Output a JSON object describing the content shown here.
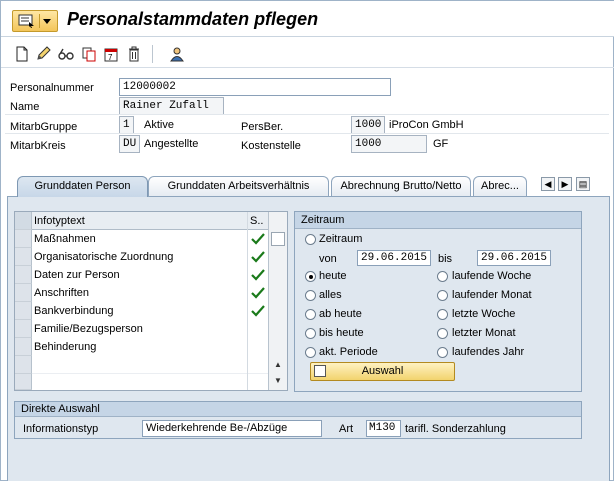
{
  "window": {
    "title": "Personalstammdaten pflegen"
  },
  "toolbar": {
    "icons": [
      "create-icon",
      "change-icon",
      "display-icon",
      "copy-icon",
      "delimit-icon",
      "delete-icon",
      "person-icon"
    ]
  },
  "header": {
    "personalnummer_label": "Personalnummer",
    "personalnummer_value": "12000002",
    "name_label": "Name",
    "name_value": "Rainer Zufall",
    "mitarbgruppe_label": "MitarbGruppe",
    "mitarbgruppe_code": "1",
    "mitarbgruppe_text": "Aktive",
    "persber_label": "PersBer.",
    "persber_code": "1000",
    "persber_text": "iProCon GmbH",
    "mitarbkreis_label": "MitarbKreis",
    "mitarbkreis_code": "DU",
    "mitarbkreis_text": "Angestellte",
    "kostenstelle_label": "Kostenstelle",
    "kostenstelle_code": "1000",
    "kostenstelle_text": "GF"
  },
  "tabs": [
    {
      "label": "Grunddaten Person",
      "active": true
    },
    {
      "label": "Grunddaten Arbeitsverhältnis",
      "active": false
    },
    {
      "label": "Abrechnung Brutto/Netto",
      "active": false
    },
    {
      "label": "Abrec...",
      "active": false
    }
  ],
  "infotypen": {
    "col_text": "Infotyptext",
    "col_s": "S..",
    "rows": [
      {
        "text": "Maßnahmen",
        "checked": true
      },
      {
        "text": "Organisatorische Zuordnung",
        "checked": true
      },
      {
        "text": "Daten zur Person",
        "checked": true
      },
      {
        "text": "Anschriften",
        "checked": true
      },
      {
        "text": "Bankverbindung",
        "checked": true
      },
      {
        "text": "Familie/Bezugsperson",
        "checked": false
      },
      {
        "text": "Behinderung",
        "checked": false
      }
    ]
  },
  "zeitraum": {
    "title": "Zeitraum",
    "option_zeitraum": "Zeitraum",
    "von_label": "von",
    "von_value": "29.06.2015",
    "bis_label": "bis",
    "bis_value": "29.06.2015",
    "options_left": [
      "heute",
      "alles",
      "ab heute",
      "bis heute",
      "akt. Periode"
    ],
    "options_right": [
      "laufende Woche",
      "laufender Monat",
      "letzte Woche",
      "letzter Monat",
      "laufendes Jahr"
    ],
    "selected": "heute",
    "auswahl_label": "Auswahl"
  },
  "direkte_auswahl": {
    "title": "Direkte Auswahl",
    "infotyp_label": "Informationstyp",
    "infotyp_value": "Wiederkehrende Be-/Abzüge",
    "art_label": "Art",
    "art_value": "M130",
    "art_text": "tarifl. Sonderzahlung"
  }
}
